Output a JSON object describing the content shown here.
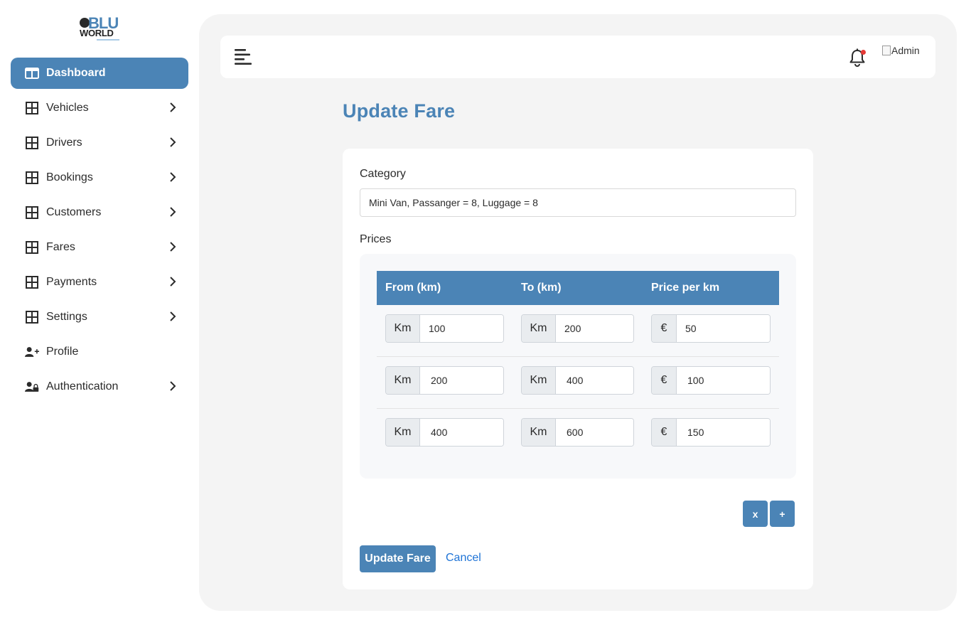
{
  "brand": {
    "logo_line1": "BLU",
    "logo_line2": "WORLD"
  },
  "sidebar": {
    "items": [
      {
        "label": "Dashboard",
        "icon": "layout-icon",
        "active": true,
        "has_chevron": false
      },
      {
        "label": "Vehicles",
        "icon": "grid-icon",
        "active": false,
        "has_chevron": true
      },
      {
        "label": "Drivers",
        "icon": "grid-icon",
        "active": false,
        "has_chevron": true
      },
      {
        "label": "Bookings",
        "icon": "grid-icon",
        "active": false,
        "has_chevron": true
      },
      {
        "label": "Customers",
        "icon": "grid-icon",
        "active": false,
        "has_chevron": true
      },
      {
        "label": "Fares",
        "icon": "grid-icon",
        "active": false,
        "has_chevron": true
      },
      {
        "label": "Payments",
        "icon": "grid-icon",
        "active": false,
        "has_chevron": true
      },
      {
        "label": "Settings",
        "icon": "grid-icon",
        "active": false,
        "has_chevron": true
      },
      {
        "label": "Profile",
        "icon": "user-plus-icon",
        "active": false,
        "has_chevron": false
      },
      {
        "label": "Authentication",
        "icon": "user-lock-icon",
        "active": false,
        "has_chevron": true
      }
    ]
  },
  "topbar": {
    "admin_alt": "Admin",
    "has_notification": true
  },
  "page": {
    "title": "Update Fare"
  },
  "form": {
    "category_label": "Category",
    "category_value": "Mini Van, Passanger = 8, Luggage = 8",
    "prices_label": "Prices",
    "columns": [
      "From (km)",
      "To (km)",
      "Price per km"
    ],
    "rows": [
      {
        "from_unit": "Km",
        "from": "100",
        "to_unit": "Km",
        "to": "200",
        "price_unit": "€",
        "price": "50"
      },
      {
        "from_unit": "Km",
        "from": "200",
        "to_unit": "Km",
        "to": "400",
        "price_unit": "€",
        "price": "100"
      },
      {
        "from_unit": "Km",
        "from": "400",
        "to_unit": "Km",
        "to": "600",
        "price_unit": "€",
        "price": "150"
      }
    ],
    "remove_row_label": "x",
    "add_row_label": "+",
    "submit_label": "Update Fare",
    "cancel_label": "Cancel"
  },
  "colors": {
    "accent": "#4b84b6",
    "link": "#1e73d6",
    "panel_bg": "#f4f4f4",
    "notification": "#e53935"
  }
}
